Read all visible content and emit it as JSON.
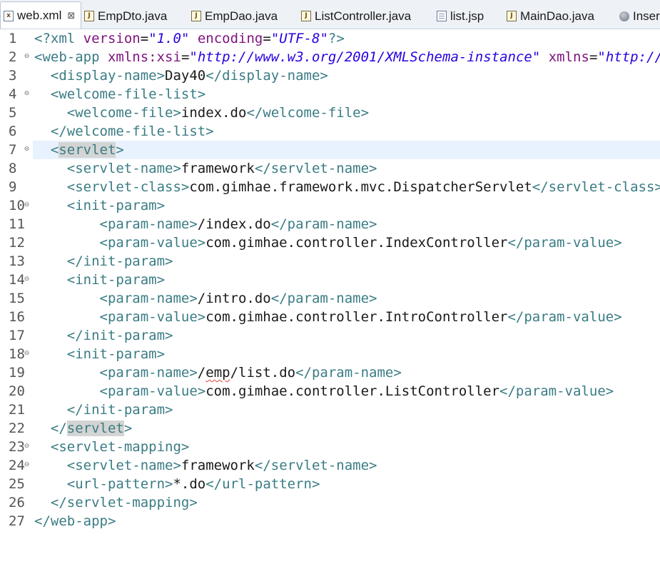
{
  "tabs": [
    {
      "label": "web.xml",
      "icon": "xml-file-icon",
      "active": true,
      "close": "⊠"
    },
    {
      "label": "EmpDto.java",
      "icon": "java-file-icon"
    },
    {
      "label": "EmpDao.java",
      "icon": "java-file-icon"
    },
    {
      "label": "ListController.java",
      "icon": "java-file-icon"
    },
    {
      "label": "list.jsp",
      "icon": "jsp-file-icon"
    },
    {
      "label": "MainDao.java",
      "icon": "java-file-icon"
    },
    {
      "label": "Inser",
      "icon": "globe-icon"
    }
  ],
  "editor": {
    "current_line": 7,
    "lines": [
      {
        "n": "1",
        "fold": "",
        "indent": "",
        "tokens": [
          [
            "pi",
            "<?"
          ],
          [
            "pi",
            "xml"
          ],
          [
            "txt",
            " "
          ],
          [
            "attr",
            "version"
          ],
          [
            "eq",
            "="
          ],
          [
            "str",
            "\"1.0\""
          ],
          [
            "txt",
            " "
          ],
          [
            "attr",
            "encoding"
          ],
          [
            "eq",
            "="
          ],
          [
            "str",
            "\"UTF-8\""
          ],
          [
            "pi",
            "?>"
          ]
        ]
      },
      {
        "n": "2",
        "fold": "⊖",
        "indent": "",
        "tokens": [
          [
            "tag",
            "<"
          ],
          [
            "tag",
            "web-app"
          ],
          [
            "txt",
            " "
          ],
          [
            "attr",
            "xmlns:xsi"
          ],
          [
            "eq",
            "="
          ],
          [
            "str",
            "\"http://www.w3.org/2001/XMLSchema-instance\""
          ],
          [
            "txt",
            " "
          ],
          [
            "attr",
            "xmlns"
          ],
          [
            "eq",
            "="
          ],
          [
            "str",
            "\"http://xml"
          ]
        ]
      },
      {
        "n": "3",
        "fold": "",
        "indent": "  ",
        "tokens": [
          [
            "tag",
            "<display-name>"
          ],
          [
            "txt",
            "Day40"
          ],
          [
            "tag",
            "</display-name>"
          ]
        ]
      },
      {
        "n": "4",
        "fold": "⊖",
        "indent": "  ",
        "tokens": [
          [
            "tag",
            "<welcome-file-list>"
          ]
        ]
      },
      {
        "n": "5",
        "fold": "",
        "indent": "    ",
        "tokens": [
          [
            "tag",
            "<welcome-file>"
          ],
          [
            "txt",
            "index.do"
          ],
          [
            "tag",
            "</welcome-file>"
          ]
        ]
      },
      {
        "n": "6",
        "fold": "",
        "indent": "  ",
        "tokens": [
          [
            "tag",
            "</welcome-file-list>"
          ]
        ]
      },
      {
        "n": "7",
        "fold": "⊖",
        "indent": "  ",
        "tokens": [
          [
            "tag",
            "<"
          ],
          [
            "hltag",
            "servlet"
          ],
          [
            "tag",
            ">"
          ]
        ]
      },
      {
        "n": "8",
        "fold": "",
        "indent": "    ",
        "tokens": [
          [
            "tag",
            "<servlet-name>"
          ],
          [
            "txt",
            "framework"
          ],
          [
            "tag",
            "</servlet-name>"
          ]
        ]
      },
      {
        "n": "9",
        "fold": "",
        "indent": "    ",
        "tokens": [
          [
            "tag",
            "<servlet-class>"
          ],
          [
            "txt",
            "com.gimhae.framework.mvc.DispatcherServlet"
          ],
          [
            "tag",
            "</servlet-class>"
          ]
        ]
      },
      {
        "n": "10",
        "fold": "⊖",
        "indent": "    ",
        "tokens": [
          [
            "tag",
            "<init-param>"
          ]
        ]
      },
      {
        "n": "11",
        "fold": "",
        "indent": "        ",
        "tokens": [
          [
            "tag",
            "<param-name>"
          ],
          [
            "txt",
            "/index.do"
          ],
          [
            "tag",
            "</param-name>"
          ]
        ]
      },
      {
        "n": "12",
        "fold": "",
        "indent": "        ",
        "tokens": [
          [
            "tag",
            "<param-value>"
          ],
          [
            "txt",
            "com.gimhae.controller.IndexController"
          ],
          [
            "tag",
            "</param-value>"
          ]
        ]
      },
      {
        "n": "13",
        "fold": "",
        "indent": "    ",
        "tokens": [
          [
            "tag",
            "</init-param>"
          ]
        ]
      },
      {
        "n": "14",
        "fold": "⊖",
        "indent": "    ",
        "tokens": [
          [
            "tag",
            "<init-param>"
          ]
        ]
      },
      {
        "n": "15",
        "fold": "",
        "indent": "        ",
        "tokens": [
          [
            "tag",
            "<param-name>"
          ],
          [
            "txt",
            "/intro.do"
          ],
          [
            "tag",
            "</param-name>"
          ]
        ]
      },
      {
        "n": "16",
        "fold": "",
        "indent": "        ",
        "tokens": [
          [
            "tag",
            "<param-value>"
          ],
          [
            "txt",
            "com.gimhae.controller.IntroController"
          ],
          [
            "tag",
            "</param-value>"
          ]
        ]
      },
      {
        "n": "17",
        "fold": "",
        "indent": "    ",
        "tokens": [
          [
            "tag",
            "</init-param>"
          ]
        ]
      },
      {
        "n": "18",
        "fold": "⊖",
        "indent": "    ",
        "tokens": [
          [
            "tag",
            "<init-param>"
          ]
        ]
      },
      {
        "n": "19",
        "fold": "",
        "indent": "        ",
        "tokens": [
          [
            "tag",
            "<param-name>"
          ],
          [
            "txt",
            "/"
          ],
          [
            "sqtxt",
            "emp"
          ],
          [
            "txt",
            "/list.do"
          ],
          [
            "tag",
            "</param-name>"
          ]
        ]
      },
      {
        "n": "20",
        "fold": "",
        "indent": "        ",
        "tokens": [
          [
            "tag",
            "<param-value>"
          ],
          [
            "txt",
            "com.gimhae.controller.ListController"
          ],
          [
            "tag",
            "</param-value>"
          ]
        ]
      },
      {
        "n": "21",
        "fold": "",
        "indent": "    ",
        "tokens": [
          [
            "tag",
            "</init-param>"
          ]
        ]
      },
      {
        "n": "22",
        "fold": "",
        "indent": "  ",
        "tokens": [
          [
            "tag",
            "</"
          ],
          [
            "hltag",
            "servlet"
          ],
          [
            "tag",
            ">"
          ]
        ]
      },
      {
        "n": "23",
        "fold": "⊖",
        "indent": "  ",
        "tokens": [
          [
            "tag",
            "<servlet-mapping>"
          ]
        ]
      },
      {
        "n": "24",
        "fold": "⊖",
        "indent": "    ",
        "tokens": [
          [
            "tag",
            "<servlet-name>"
          ],
          [
            "txt",
            "framework"
          ],
          [
            "tag",
            "</servlet-name>"
          ]
        ]
      },
      {
        "n": "25",
        "fold": "",
        "indent": "    ",
        "tokens": [
          [
            "tag",
            "<url-pattern>"
          ],
          [
            "txt",
            "*.do"
          ],
          [
            "tag",
            "</url-pattern>"
          ]
        ]
      },
      {
        "n": "26",
        "fold": "",
        "indent": "  ",
        "tokens": [
          [
            "tag",
            "</servlet-mapping>"
          ]
        ]
      },
      {
        "n": "27",
        "fold": "",
        "indent": "",
        "tokens": [
          [
            "tag",
            "</web-app>"
          ]
        ]
      }
    ]
  },
  "colors": {
    "tag": "#3a7c84",
    "text": "#1a1a1a",
    "attribute": "#7f127f",
    "string": "#2a00e0",
    "current_line": "#e8f2fe",
    "scope_bar": "#5f88b6"
  }
}
